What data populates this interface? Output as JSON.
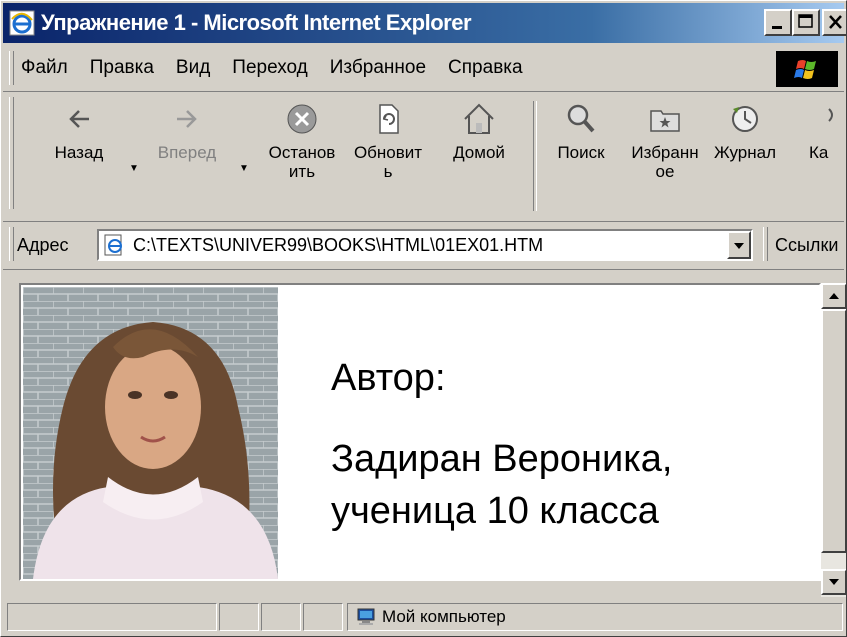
{
  "window": {
    "title": "Упражнение 1 - Microsoft Internet Explorer",
    "controls": [
      "minimize",
      "maximize",
      "close"
    ]
  },
  "menu": {
    "items": [
      "Файл",
      "Правка",
      "Вид",
      "Переход",
      "Избранное",
      "Справка"
    ]
  },
  "toolbar": {
    "buttons": [
      {
        "label": "Назад",
        "icon": "back-arrow-icon"
      },
      {
        "label": "Вперед",
        "icon": "forward-arrow-icon"
      },
      {
        "label": "Останов\nить",
        "icon": "stop-icon"
      },
      {
        "label": "Обновит\nь",
        "icon": "refresh-icon"
      },
      {
        "label": "Домой",
        "icon": "home-icon"
      },
      {
        "label": "Поиск",
        "icon": "search-icon"
      },
      {
        "label": "Избранн\nое",
        "icon": "favorites-icon"
      },
      {
        "label": "Журнал",
        "icon": "history-icon"
      },
      {
        "label": "Ка",
        "icon": "channels-icon"
      }
    ]
  },
  "address": {
    "label": "Адрес",
    "url": "C:\\TEXTS\\UNIVER99\\BOOKS\\HTML\\01EX01.HTM",
    "links_label": "Ссылки"
  },
  "page": {
    "author_label": "Автор:",
    "author_name_line1": "Задиран Вероника,",
    "author_name_line2": "ученица 10 класса"
  },
  "status": {
    "zone": "Мой компьютер"
  }
}
